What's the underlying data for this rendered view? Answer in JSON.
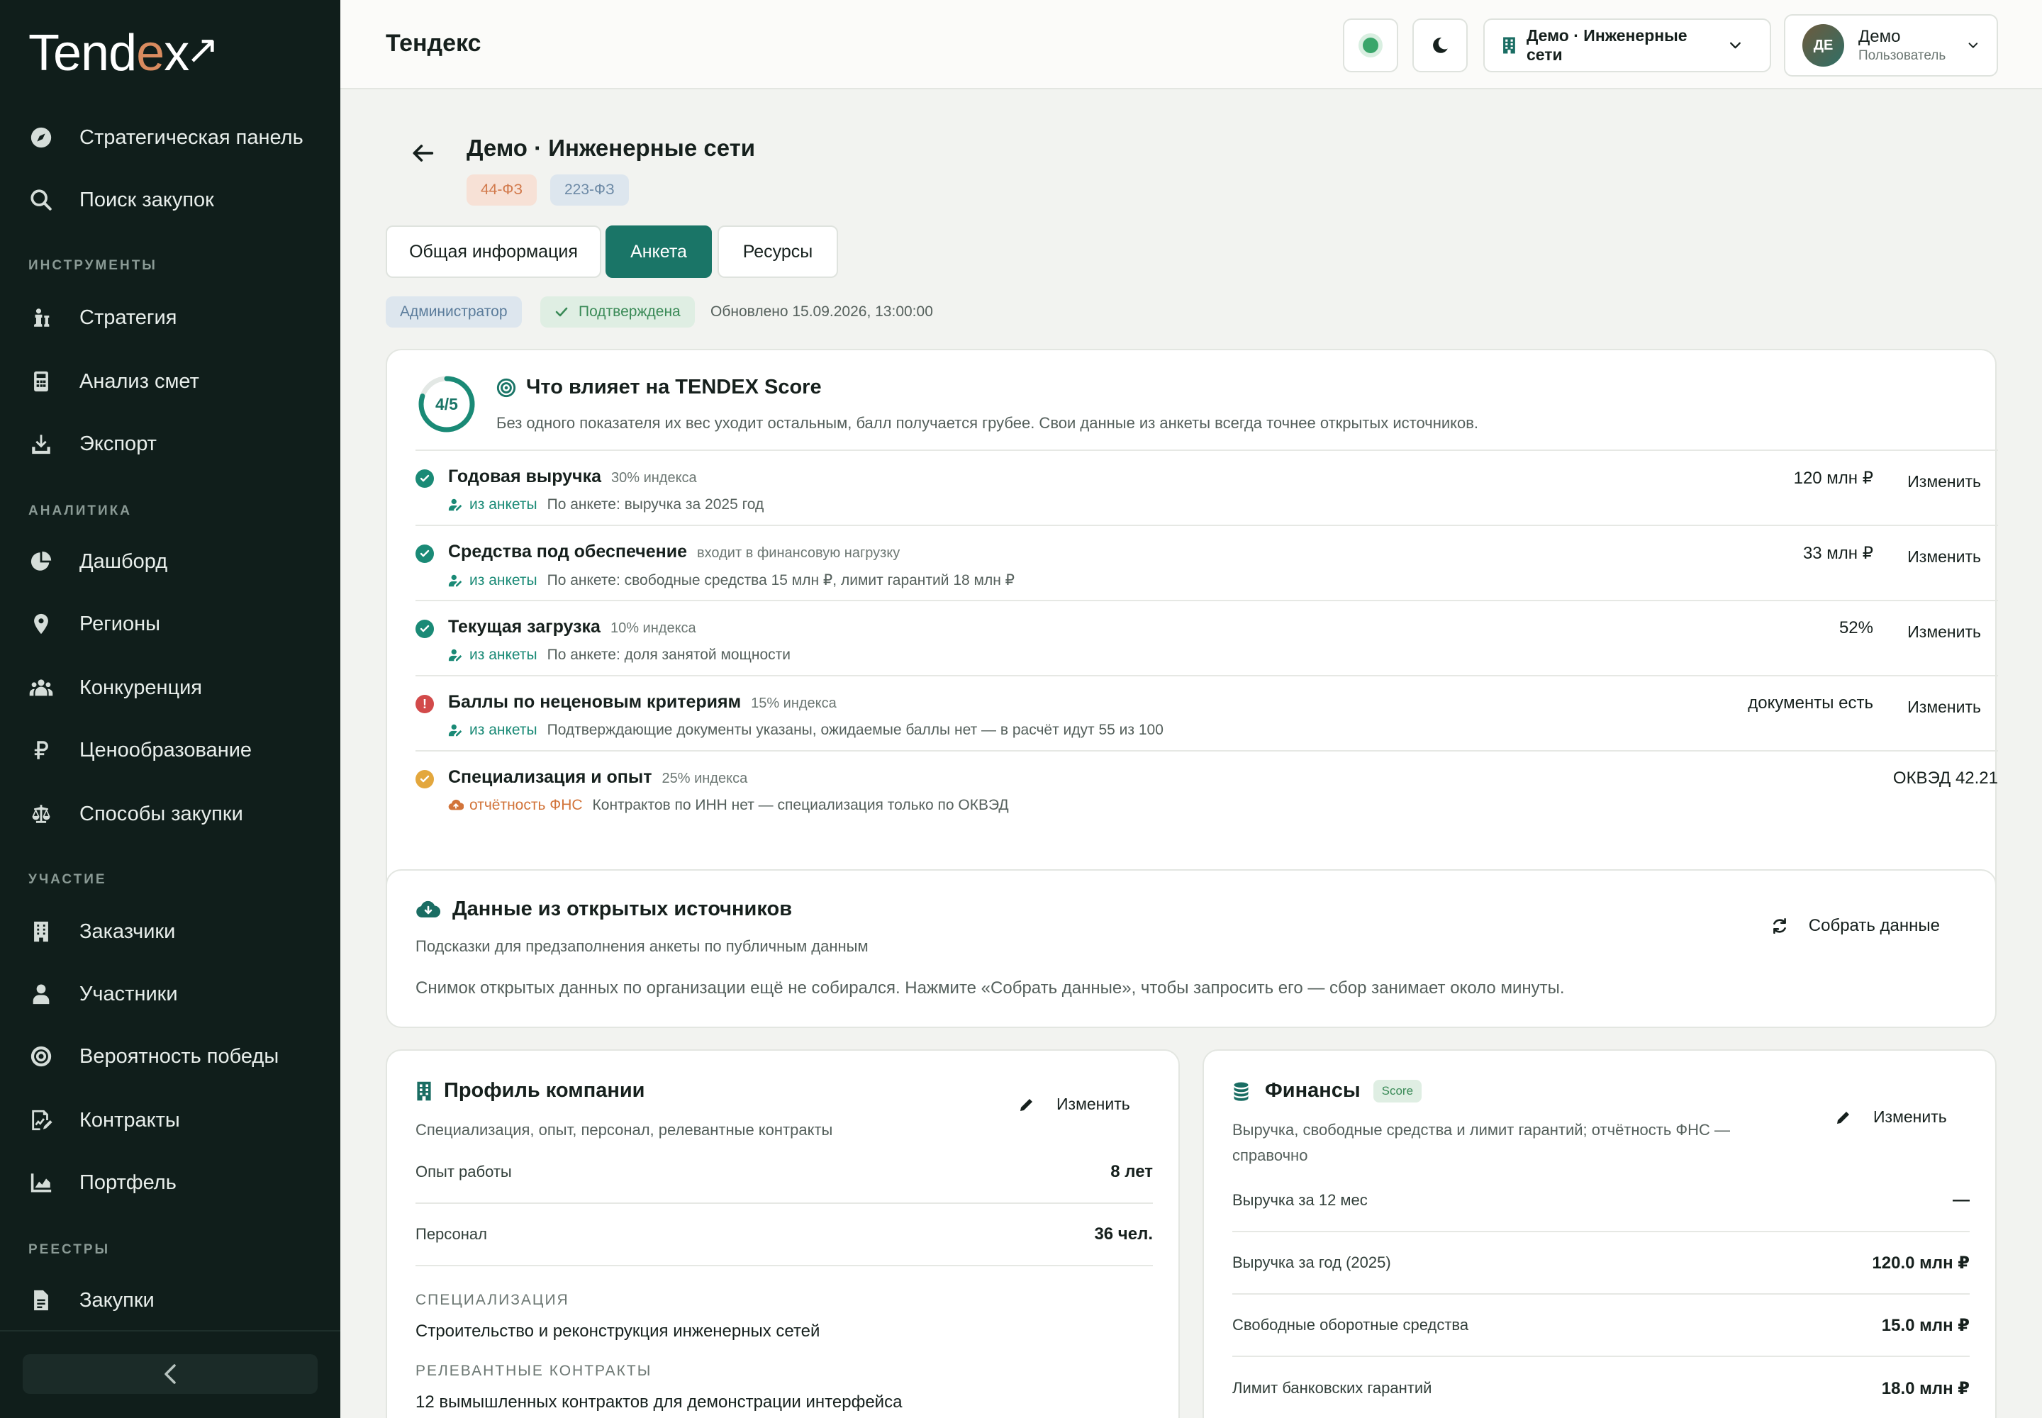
{
  "brand": {
    "logo_pre": "Tend",
    "logo_accent": "e",
    "logo_post": "x",
    "logo_arrow": "↗"
  },
  "sidebar": {
    "top_items": [
      {
        "label": "Стратегическая панель",
        "icon": "compass-icon"
      },
      {
        "label": "Поиск закупок",
        "icon": "search-icon"
      }
    ],
    "sections": {
      "tools": "ИНСТРУМЕНТЫ",
      "analytics": "АНАЛИТИКА",
      "participation": "УЧАСТИЕ",
      "registries": "РЕЕСТРЫ"
    },
    "tools_items": [
      {
        "label": "Стратегия",
        "icon": "chess-icon"
      },
      {
        "label": "Анализ смет",
        "icon": "calculator-icon"
      },
      {
        "label": "Экспорт",
        "icon": "download-icon"
      }
    ],
    "analytics_items": [
      {
        "label": "Дашборд",
        "icon": "pie-chart-icon"
      },
      {
        "label": "Регионы",
        "icon": "map-pin-icon"
      },
      {
        "label": "Конкуренция",
        "icon": "users-icon"
      },
      {
        "label": "Ценообразование",
        "icon": "ruble-icon"
      },
      {
        "label": "Способы закупки",
        "icon": "scales-icon"
      }
    ],
    "participation_items": [
      {
        "label": "Заказчики",
        "icon": "building-icon"
      },
      {
        "label": "Участники",
        "icon": "person-icon"
      },
      {
        "label": "Вероятность победы",
        "icon": "target-icon"
      },
      {
        "label": "Контракты",
        "icon": "signed-document-icon"
      },
      {
        "label": "Портфель",
        "icon": "area-chart-icon"
      }
    ],
    "registries_items": [
      {
        "label": "Закупки",
        "icon": "file-icon"
      }
    ],
    "collapse": "‹"
  },
  "topbar": {
    "title": "Тендекс",
    "org": "Демо · Инженерные сети",
    "user_initials": "ДЕ",
    "user_name": "Демо",
    "user_role": "Пользователь"
  },
  "page": {
    "title": "Демо · Инженерные сети",
    "chips": [
      "44-ФЗ",
      "223-ФЗ"
    ],
    "tabs": [
      "Общая информация",
      "Анкета",
      "Ресурсы"
    ],
    "active_tab": "Анкета",
    "role_chip": "Администратор",
    "status_chip": "Подтверждена",
    "updated": "Обновлено 15.09.2026, 13:00:00"
  },
  "score": {
    "ring_label": "4/5",
    "ring_progress": 0.8,
    "title": "Что влияет на TENDEX Score",
    "subtitle": "Без одного показателя их вес уходит остальным, балл получается грубее. Свои данные из анкеты всегда точнее открытых источников.",
    "edit_label": "Изменить",
    "factors": [
      {
        "status": "ok",
        "name": "Годовая выручка",
        "weight": "30% индекса",
        "source": "из анкеты",
        "desc": "По анкете: выручка за 2025 год",
        "value": "120 млн ₽",
        "editable": true
      },
      {
        "status": "ok",
        "name": "Средства под обеспечение",
        "weight": "входит в финансовую нагрузку",
        "source": "из анкеты",
        "desc": "По анкете: свободные средства 15 млн ₽, лимит гарантий 18 млн ₽",
        "value": "33 млн ₽",
        "editable": true
      },
      {
        "status": "ok",
        "name": "Текущая загрузка",
        "weight": "10% индекса",
        "source": "из анкеты",
        "desc": "По анкете: доля занятой мощности",
        "value": "52%",
        "editable": true
      },
      {
        "status": "err",
        "name": "Баллы по неценовым критериям",
        "weight": "15% индекса",
        "source": "из анкеты",
        "desc": "Подтверждающие документы указаны, ожидаемые баллы нет — в расчёт идут 55 из 100",
        "value": "документы есть",
        "editable": true
      },
      {
        "status": "warn",
        "name": "Специализация и опыт",
        "weight": "25% индекса",
        "source": "отчётность ФНС",
        "desc": "Контрактов по ИНН нет — специализация только по ОКВЭД",
        "value": "ОКВЭД 42.21",
        "editable": false
      }
    ]
  },
  "open_data": {
    "title": "Данные из открытых источников",
    "subtitle": "Подсказки для предзаполнения анкеты по публичным данным",
    "text": "Снимок открытых данных по организации ещё не собирался. Нажмите «Собрать данные», чтобы запросить его — сбор занимает около минуты.",
    "collect_label": "Собрать данные"
  },
  "profile": {
    "title": "Профиль компании",
    "subtitle": "Специализация, опыт, персонал, релевантные контракты",
    "edit_label": "Изменить",
    "rows": [
      {
        "k": "Опыт работы",
        "v": "8 лет"
      },
      {
        "k": "Персонал",
        "v": "36 чел."
      }
    ],
    "spec_caption": "СПЕЦИАЛИЗАЦИЯ",
    "spec_value": "Строительство и реконструкция инженерных сетей",
    "contracts_caption": "РЕЛЕВАНТНЫЕ КОНТРАКТЫ",
    "contracts_value": "12 вымышленных контрактов для демонстрации интерфейса"
  },
  "finance": {
    "title": "Финансы",
    "badge": "Score",
    "subtitle_line1": "Выручка, свободные средства и лимит гарантий; отчётность ФНС —",
    "subtitle_line2": "справочно",
    "edit_label": "Изменить",
    "rows": [
      {
        "k": "Выручка за 12 мес",
        "v": "—"
      },
      {
        "k": "Выручка за год (2025)",
        "v": "120.0 млн ₽"
      },
      {
        "k": "Свободные оборотные средства",
        "v": "15.0 млн ₽"
      },
      {
        "k": "Лимит банковских гарантий",
        "v": "18.0 млн ₽"
      }
    ]
  }
}
